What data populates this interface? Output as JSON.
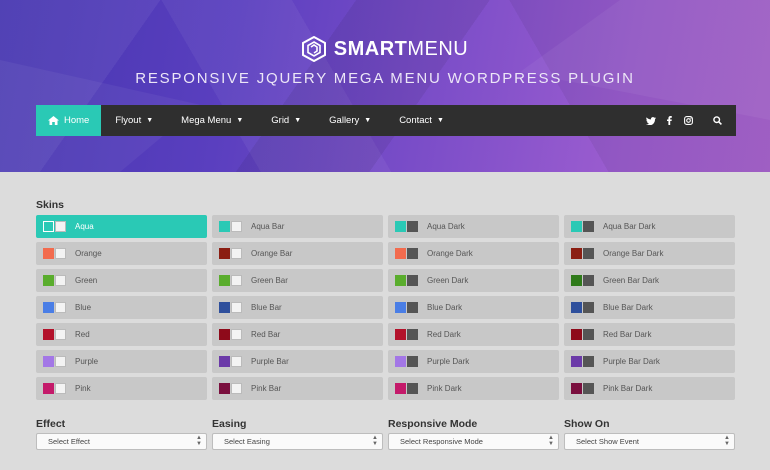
{
  "brand": {
    "bold": "SMART",
    "light": "MENU"
  },
  "tagline": "RESPONSIVE JQUERY MEGA MENU WORDPRESS PLUGIN",
  "nav": {
    "items": [
      {
        "label": "Home",
        "active": true,
        "icon": "home-icon"
      },
      {
        "label": "Flyout",
        "caret": "▼"
      },
      {
        "label": "Mega Menu",
        "caret": "▼"
      },
      {
        "label": "Grid",
        "caret": "▼"
      },
      {
        "label": "Gallery",
        "caret": "▼"
      },
      {
        "label": "Contact",
        "caret": "▼"
      }
    ],
    "social": [
      "twitter-icon",
      "facebook-icon",
      "instagram-icon"
    ],
    "search_icon": "search-icon"
  },
  "skins": {
    "title": "Skins",
    "selected": "Aqua",
    "items": [
      {
        "label": "Aqua",
        "color": "#2ac9b5",
        "variant": "light"
      },
      {
        "label": "Aqua Bar",
        "color": "#2ac9b5",
        "variant": "bar"
      },
      {
        "label": "Aqua Dark",
        "color": "#2ac9b5",
        "variant": "dark"
      },
      {
        "label": "Aqua Bar Dark",
        "color": "#2ac9b5",
        "variant": "bar-dark"
      },
      {
        "label": "Orange",
        "color": "#f26b4e",
        "variant": "light"
      },
      {
        "label": "Orange Bar",
        "color": "#8b1e12",
        "variant": "bar"
      },
      {
        "label": "Orange Dark",
        "color": "#f26b4e",
        "variant": "dark"
      },
      {
        "label": "Orange Bar Dark",
        "color": "#8b1e12",
        "variant": "bar-dark"
      },
      {
        "label": "Green",
        "color": "#5aad2d",
        "variant": "light"
      },
      {
        "label": "Green Bar",
        "color": "#5aad2d",
        "variant": "bar"
      },
      {
        "label": "Green Dark",
        "color": "#5aad2d",
        "variant": "dark"
      },
      {
        "label": "Green Bar Dark",
        "color": "#2f7a1a",
        "variant": "bar-dark"
      },
      {
        "label": "Blue",
        "color": "#4a7ee6",
        "variant": "light"
      },
      {
        "label": "Blue Bar",
        "color": "#2e4f9c",
        "variant": "bar"
      },
      {
        "label": "Blue Dark",
        "color": "#4a7ee6",
        "variant": "dark"
      },
      {
        "label": "Blue Bar Dark",
        "color": "#2e4f9c",
        "variant": "bar-dark"
      },
      {
        "label": "Red",
        "color": "#b3122b",
        "variant": "light"
      },
      {
        "label": "Red Bar",
        "color": "#8e0a1a",
        "variant": "bar"
      },
      {
        "label": "Red Dark",
        "color": "#b3122b",
        "variant": "dark"
      },
      {
        "label": "Red Bar Dark",
        "color": "#8e0a1a",
        "variant": "bar-dark"
      },
      {
        "label": "Purple",
        "color": "#a377e6",
        "variant": "light"
      },
      {
        "label": "Purple Bar",
        "color": "#6b3aa8",
        "variant": "bar"
      },
      {
        "label": "Purple Dark",
        "color": "#a377e6",
        "variant": "dark"
      },
      {
        "label": "Purple Bar Dark",
        "color": "#6b3aa8",
        "variant": "bar-dark"
      },
      {
        "label": "Pink",
        "color": "#c41a6a",
        "variant": "light"
      },
      {
        "label": "Pink Bar",
        "color": "#7a0f3e",
        "variant": "bar"
      },
      {
        "label": "Pink Dark",
        "color": "#c41a6a",
        "variant": "dark"
      },
      {
        "label": "Pink Bar Dark",
        "color": "#7a0f3e",
        "variant": "bar-dark"
      }
    ]
  },
  "options": [
    {
      "label": "Effect",
      "value": "Select Effect"
    },
    {
      "label": "Easing",
      "value": "Select Easing"
    },
    {
      "label": "Responsive Mode",
      "value": "Select Responsive Mode"
    },
    {
      "label": "Show On",
      "value": "Select Show Event"
    }
  ],
  "colors": {
    "accent": "#2ac9b5",
    "navbar": "#2f2f2f",
    "page_bg": "#dcdcdc"
  }
}
